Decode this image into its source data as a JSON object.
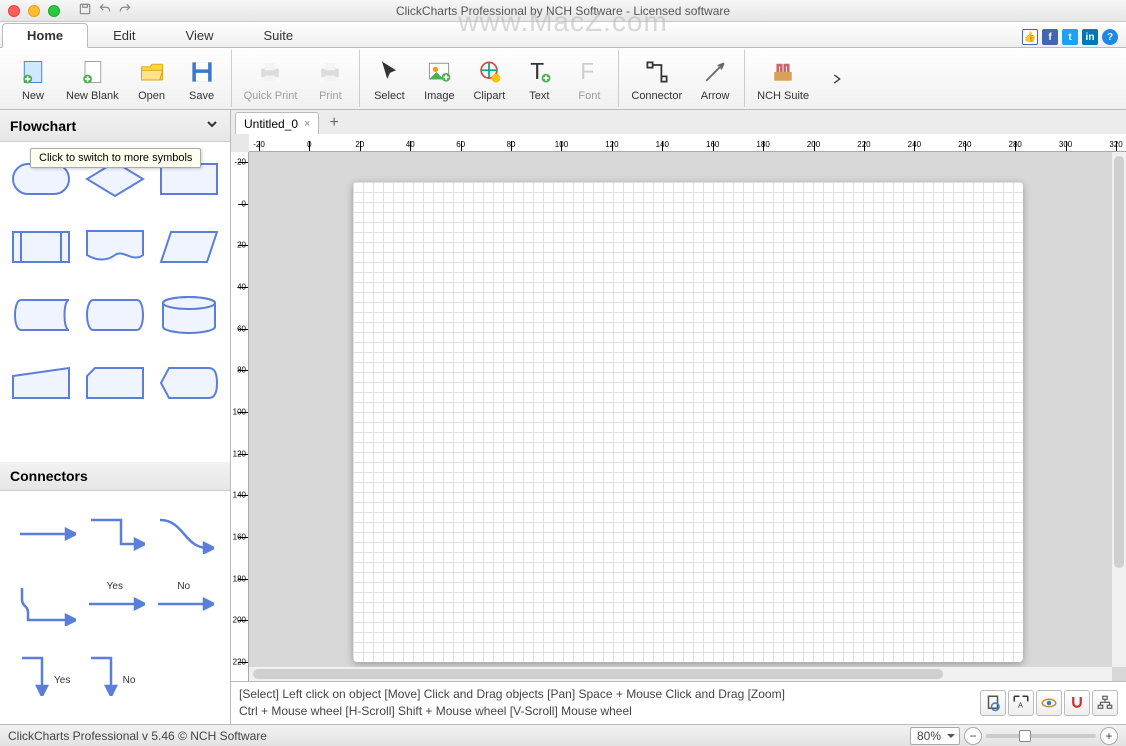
{
  "titlebar": {
    "title": "ClickCharts Professional by NCH Software - Licensed software"
  },
  "watermark": "www.MacZ.com",
  "menu": {
    "tabs": [
      "Home",
      "Edit",
      "View",
      "Suite"
    ],
    "active": 0
  },
  "ribbon": {
    "new": "New",
    "new_blank": "New Blank",
    "open": "Open",
    "save": "Save",
    "quick_print": "Quick Print",
    "print": "Print",
    "select": "Select",
    "image": "Image",
    "clipart": "Clipart",
    "text": "Text",
    "font": "Font",
    "connector": "Connector",
    "arrow": "Arrow",
    "nch_suite": "NCH Suite"
  },
  "sidebar": {
    "flowchart_title": "Flowchart",
    "tooltip": "Click to switch to more symbols",
    "connectors_title": "Connectors",
    "conn_yes": "Yes",
    "conn_no": "No"
  },
  "document": {
    "tab_name": "Untitled_0"
  },
  "ruler": {
    "h_ticks": [
      -20,
      0,
      20,
      40,
      60,
      80,
      100,
      120,
      140,
      160,
      180,
      200,
      220,
      240,
      260,
      280,
      300,
      320
    ],
    "v_ticks": [
      -20,
      0,
      20,
      40,
      60,
      80,
      100,
      120,
      140,
      160,
      180,
      200,
      220
    ]
  },
  "hints": {
    "line1": "[Select] Left click on object  [Move] Click and Drag objects  [Pan] Space + Mouse Click and Drag  [Zoom] ",
    "line2": "Ctrl + Mouse wheel  [H-Scroll] Shift + Mouse wheel  [V-Scroll] Mouse wheel"
  },
  "status": {
    "product": "ClickCharts Professional v 5.46 © NCH Software",
    "zoom": "80%"
  }
}
